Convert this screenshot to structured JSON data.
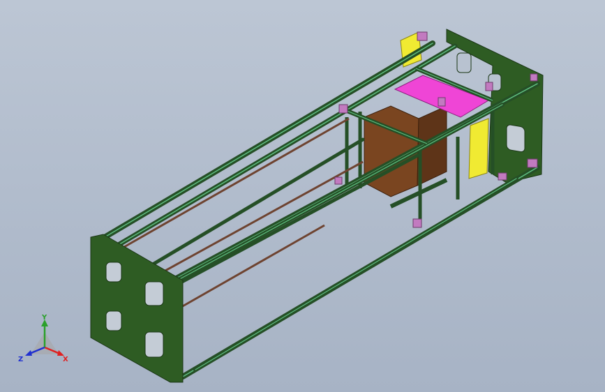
{
  "viewport": {
    "background_top": "#bcc6d4",
    "background_bottom": "#a7b3c5"
  },
  "model": {
    "frame_color": "#254f26",
    "frame_highlight": "#5fbf82",
    "plate_color": "#2e5c23",
    "bracket_color": "#c27ac0",
    "carriage_color": "#7a4520",
    "top_plate_color": "#ef45d6",
    "side_panel_color": "#f0ea32",
    "rod_color": "#6e4330"
  },
  "triad": {
    "x_label": "X",
    "y_label": "Y",
    "z_label": "Z",
    "x_color": "#e02020",
    "y_color": "#2aa02a",
    "z_color": "#2030d0"
  }
}
